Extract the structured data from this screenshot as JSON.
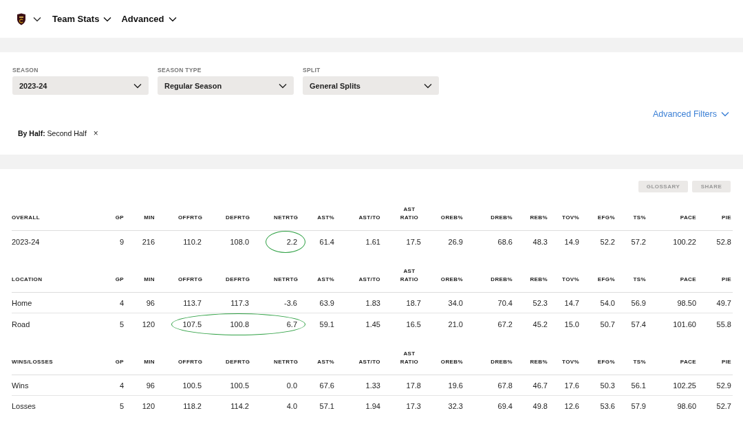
{
  "nav": {
    "items": [
      {
        "label": "Team Stats"
      },
      {
        "label": "Advanced"
      }
    ]
  },
  "filters": {
    "dropdowns": [
      {
        "label": "SEASON",
        "value": "2023-24"
      },
      {
        "label": "SEASON TYPE",
        "value": "Regular Season"
      },
      {
        "label": "SPLIT",
        "value": "General Splits"
      }
    ],
    "advanced_link": "Advanced Filters",
    "chip": {
      "label": "By Half:",
      "value": "Second Half",
      "close": "×"
    }
  },
  "buttons": [
    "GLOSSARY",
    "SHARE"
  ],
  "sections": [
    {
      "columns": [
        "OVERALL",
        "GP",
        "MIN",
        "OFFRTG",
        "DEFRTG",
        "NETRTG",
        "AST%",
        "AST/TO",
        "AST RATIO",
        "OREB%",
        "DREB%",
        "REB%",
        "TOV%",
        "EFG%",
        "TS%",
        "PACE",
        "PIE"
      ],
      "rows": [
        {
          "cells": [
            {
              "text": "2023-24",
              "circled": false
            },
            {
              "text": "9",
              "circled": false
            },
            {
              "text": "216",
              "circled": false
            },
            {
              "text": "110.2",
              "circled": false
            },
            {
              "text": "108.0",
              "circled": false
            },
            {
              "text": "2.2",
              "circled": true
            },
            {
              "text": "61.4",
              "circled": false
            },
            {
              "text": "1.61",
              "circled": false
            },
            {
              "text": "17.5",
              "circled": false
            },
            {
              "text": "26.9",
              "circled": false
            },
            {
              "text": "68.6",
              "circled": false
            },
            {
              "text": "48.3",
              "circled": false
            },
            {
              "text": "14.9",
              "circled": false
            },
            {
              "text": "52.2",
              "circled": false
            },
            {
              "text": "57.2",
              "circled": false
            },
            {
              "text": "100.22",
              "circled": false
            },
            {
              "text": "52.8",
              "circled": false
            }
          ]
        }
      ]
    },
    {
      "columns": [
        "LOCATION",
        "GP",
        "MIN",
        "OFFRTG",
        "DEFRTG",
        "NETRTG",
        "AST%",
        "AST/TO",
        "AST RATIO",
        "OREB%",
        "DREB%",
        "REB%",
        "TOV%",
        "EFG%",
        "TS%",
        "PACE",
        "PIE"
      ],
      "rows": [
        {
          "cells": [
            {
              "text": "Home",
              "circled": false
            },
            {
              "text": "4",
              "circled": false
            },
            {
              "text": "96",
              "circled": false
            },
            {
              "text": "113.7",
              "circled": false
            },
            {
              "text": "117.3",
              "circled": false
            },
            {
              "text": "-3.6",
              "circled": false
            },
            {
              "text": "63.9",
              "circled": false
            },
            {
              "text": "1.83",
              "circled": false
            },
            {
              "text": "18.7",
              "circled": false
            },
            {
              "text": "34.0",
              "circled": false
            },
            {
              "text": "70.4",
              "circled": false
            },
            {
              "text": "52.3",
              "circled": false
            },
            {
              "text": "14.7",
              "circled": false
            },
            {
              "text": "54.0",
              "circled": false
            },
            {
              "text": "56.9",
              "circled": false
            },
            {
              "text": "98.50",
              "circled": false
            },
            {
              "text": "49.7",
              "circled": false
            }
          ]
        },
        {
          "cells": [
            {
              "text": "Road",
              "circled": false
            },
            {
              "text": "5",
              "circled": false
            },
            {
              "text": "120",
              "circled": false
            },
            {
              "text": "107.5",
              "circled": true
            },
            {
              "text": "100.8",
              "circled": true
            },
            {
              "text": "6.7",
              "circled": true
            },
            {
              "text": "59.1",
              "circled": false
            },
            {
              "text": "1.45",
              "circled": false
            },
            {
              "text": "16.5",
              "circled": false
            },
            {
              "text": "21.0",
              "circled": false
            },
            {
              "text": "67.2",
              "circled": false
            },
            {
              "text": "45.2",
              "circled": false
            },
            {
              "text": "15.0",
              "circled": false
            },
            {
              "text": "50.7",
              "circled": false
            },
            {
              "text": "57.4",
              "circled": false
            },
            {
              "text": "101.60",
              "circled": false
            },
            {
              "text": "55.8",
              "circled": false
            }
          ]
        }
      ]
    },
    {
      "columns": [
        "WINS/LOSSES",
        "GP",
        "MIN",
        "OFFRTG",
        "DEFRTG",
        "NETRTG",
        "AST%",
        "AST/TO",
        "AST RATIO",
        "OREB%",
        "DREB%",
        "REB%",
        "TOV%",
        "EFG%",
        "TS%",
        "PACE",
        "PIE"
      ],
      "rows": [
        {
          "cells": [
            {
              "text": "Wins",
              "circled": false
            },
            {
              "text": "4",
              "circled": false
            },
            {
              "text": "96",
              "circled": false
            },
            {
              "text": "100.5",
              "circled": false
            },
            {
              "text": "100.5",
              "circled": false
            },
            {
              "text": "0.0",
              "circled": false
            },
            {
              "text": "67.6",
              "circled": false
            },
            {
              "text": "1.33",
              "circled": false
            },
            {
              "text": "17.8",
              "circled": false
            },
            {
              "text": "19.6",
              "circled": false
            },
            {
              "text": "67.8",
              "circled": false
            },
            {
              "text": "46.7",
              "circled": false
            },
            {
              "text": "17.6",
              "circled": false
            },
            {
              "text": "50.3",
              "circled": false
            },
            {
              "text": "56.1",
              "circled": false
            },
            {
              "text": "102.25",
              "circled": false
            },
            {
              "text": "52.9",
              "circled": false
            }
          ]
        },
        {
          "cells": [
            {
              "text": "Losses",
              "circled": false
            },
            {
              "text": "5",
              "circled": false
            },
            {
              "text": "120",
              "circled": false
            },
            {
              "text": "118.2",
              "circled": false
            },
            {
              "text": "114.2",
              "circled": false
            },
            {
              "text": "4.0",
              "circled": false
            },
            {
              "text": "57.1",
              "circled": false
            },
            {
              "text": "1.94",
              "circled": false
            },
            {
              "text": "17.3",
              "circled": false
            },
            {
              "text": "32.3",
              "circled": false
            },
            {
              "text": "69.4",
              "circled": false
            },
            {
              "text": "49.8",
              "circled": false
            },
            {
              "text": "12.6",
              "circled": false
            },
            {
              "text": "53.6",
              "circled": false
            },
            {
              "text": "57.9",
              "circled": false
            },
            {
              "text": "98.60",
              "circled": false
            },
            {
              "text": "52.7",
              "circled": false
            }
          ]
        }
      ]
    }
  ]
}
